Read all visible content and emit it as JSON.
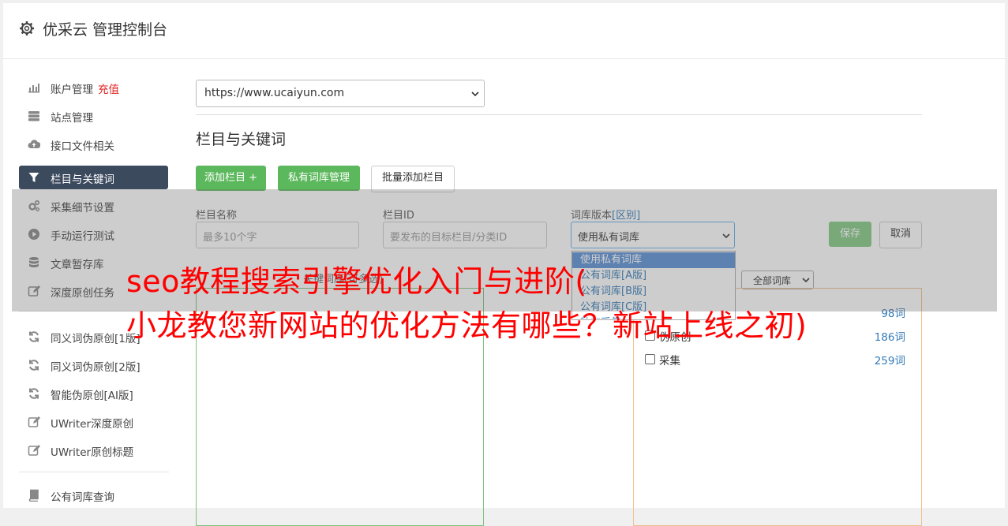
{
  "header": {
    "title": "优采云 管理控制台"
  },
  "sidebar": {
    "recharge": "充值",
    "items": [
      {
        "label": "账户管理",
        "icon": "bar-chart-icon"
      },
      {
        "label": "站点管理",
        "icon": "server-icon"
      },
      {
        "label": "接口文件相关",
        "icon": "cloud-upload-icon"
      },
      {
        "label": "栏目与关键词",
        "icon": "filter-icon"
      },
      {
        "label": "采集细节设置",
        "icon": "cogs-icon"
      },
      {
        "label": "手动运行测试",
        "icon": "play-circle-icon"
      },
      {
        "label": "文章暂存库",
        "icon": "database-icon"
      },
      {
        "label": "深度原创任务",
        "icon": "edit-icon"
      },
      {
        "label": "同义词伪原创[1版]",
        "icon": "refresh-icon"
      },
      {
        "label": "同义词伪原创[2版]",
        "icon": "refresh-icon"
      },
      {
        "label": "智能伪原创[AI版]",
        "icon": "refresh-icon"
      },
      {
        "label": "UWriter深度原创",
        "icon": "edit-icon"
      },
      {
        "label": "UWriter原创标题",
        "icon": "edit-icon"
      },
      {
        "label": "公有词库查询",
        "icon": "book-icon"
      }
    ]
  },
  "main": {
    "site_select": "https://www.ucaiyun.com",
    "section_title": "栏目与关键词",
    "buttons": {
      "add": "添加栏目 +",
      "private": "私有词库管理",
      "batch": "批量添加栏目"
    },
    "form": {
      "name_label": "栏目名称",
      "name_placeholder": "最多10个字",
      "id_label": "栏目ID",
      "id_placeholder": "要发布的目标栏目/分类ID",
      "version_label": "词库版本",
      "version_link": "[区别]",
      "version_value": "使用私有词库",
      "save": "保存",
      "cancel": "取消"
    },
    "dropdown": {
      "options": [
        "使用私有词库",
        "公有词库[A版]",
        "公有词库[B版]",
        "公有词库[C版]",
        "私有采集"
      ]
    },
    "keywords_label": "关键词库(可多选)",
    "library_filter": "全部词库",
    "keywords": [
      {
        "name": "",
        "count": "98词"
      },
      {
        "name": "伪原创",
        "count": "186词"
      },
      {
        "name": "采集",
        "count": "259词"
      }
    ]
  },
  "overlay": {
    "line1": "seo教程搜索引擎优化入门与进阶(",
    "line2": "小龙教您新网站的优化方法有哪些？新站上线之初)"
  },
  "colors": {
    "accent": "#3c4a5e",
    "green": "#5cb85c",
    "link": "#337ab7",
    "overlay_text": "#ff0000"
  }
}
